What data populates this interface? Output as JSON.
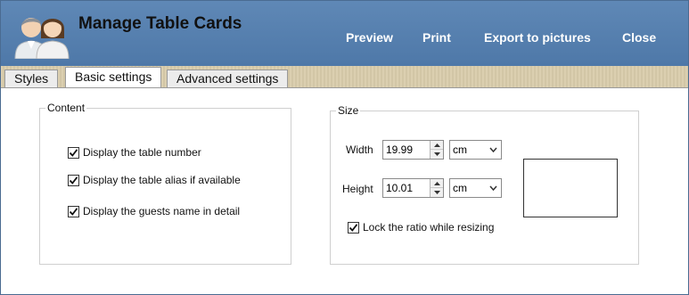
{
  "header": {
    "title": "Manage Table Cards",
    "buttons": {
      "preview": "Preview",
      "print": "Print",
      "export": "Export to pictures",
      "close": "Close"
    }
  },
  "tabs": [
    {
      "label": "Styles"
    },
    {
      "label": "Basic settings"
    },
    {
      "label": "Advanced settings"
    }
  ],
  "content_group": {
    "legend": "Content",
    "options": [
      {
        "label": "Display the table number",
        "checked": true
      },
      {
        "label": "Display the table alias if available",
        "checked": true
      },
      {
        "label": "Display the guests name in detail",
        "checked": true
      }
    ]
  },
  "size_group": {
    "legend": "Size",
    "width_label": "Width",
    "width_value": "19.99",
    "width_unit": "cm",
    "height_label": "Height",
    "height_value": "10.01",
    "height_unit": "cm",
    "lock_ratio_label": "Lock the ratio while resizing",
    "lock_ratio_checked": true
  },
  "colors": {
    "header_bg": "#5a83b2",
    "tabbar_bg": "#d9ccab",
    "header_text": "#ffffff"
  },
  "icons": {
    "avatar": "users-icon",
    "spin_up": "arrow-up-icon",
    "spin_down": "arrow-down-icon",
    "dropdown": "chevron-down-icon",
    "check": "check-icon"
  }
}
